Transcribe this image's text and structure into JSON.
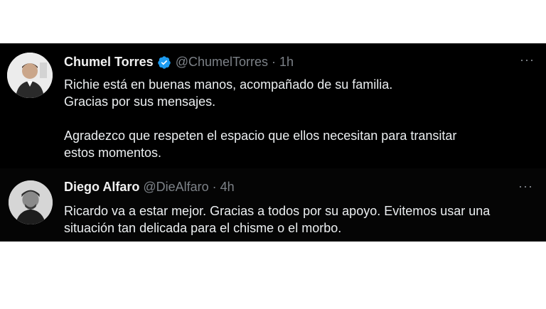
{
  "tweets": [
    {
      "name": "Chumel Torres",
      "verified": true,
      "handle": "@ChumelTorres",
      "separator": "·",
      "time": "1h",
      "more_label": "···",
      "lines": [
        "Richie está en buenas manos, acompañado de su familia.",
        "Gracias por sus mensajes.",
        "",
        "Agradezco que respeten el espacio que ellos necesitan para transitar",
        "estos momentos."
      ]
    },
    {
      "name": "Diego Alfaro",
      "verified": false,
      "handle": "@DieAlfaro",
      "separator": "·",
      "time": "4h",
      "more_label": "···",
      "lines": [
        "Ricardo va a estar mejor. Gracias a todos por su apoyo. Evitemos usar una",
        "situación tan delicada para el chisme o el morbo."
      ]
    }
  ],
  "colors": {
    "background": "#000000",
    "text": "#e7e9ea",
    "muted": "#7d8288",
    "verified": "#1d9bf0"
  },
  "icons": {
    "verified": "verified-badge-icon",
    "more": "more-options-icon"
  }
}
